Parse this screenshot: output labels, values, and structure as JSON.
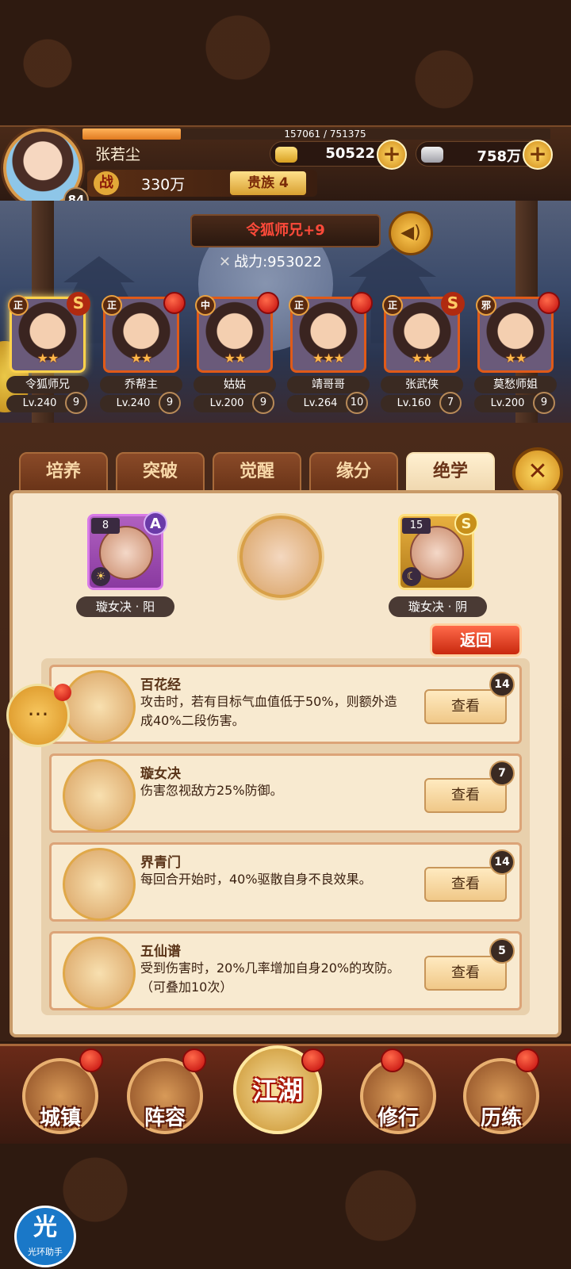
{
  "player": {
    "name": "张若尘",
    "level": "84",
    "exp_text": "157061 / 751375",
    "exp_fraction": 0.21,
    "gold": "50522",
    "silver": "758万",
    "power_icon": "战",
    "power": "330万",
    "noble": "贵族 4"
  },
  "scene": {
    "hero_title": "令狐师兄+9",
    "hero_power_label": "战力:",
    "hero_power_value": "953022",
    "sound_icon": "speaker-icon"
  },
  "heroes": [
    {
      "faction": "正",
      "name": "令狐师兄",
      "level": "Lv.240",
      "star_num": "9",
      "stars": 2,
      "badge": "S"
    },
    {
      "faction": "正",
      "name": "乔帮主",
      "level": "Lv.240",
      "star_num": "9",
      "stars": 2,
      "badge": "dot"
    },
    {
      "faction": "中",
      "name": "姑姑",
      "level": "Lv.200",
      "star_num": "9",
      "stars": 2,
      "badge": "dot"
    },
    {
      "faction": "正",
      "name": "靖哥哥",
      "level": "Lv.264",
      "star_num": "10",
      "stars": 3,
      "badge": "dot"
    },
    {
      "faction": "正",
      "name": "张武侠",
      "level": "Lv.160",
      "star_num": "7",
      "stars": 2,
      "badge": "S"
    },
    {
      "faction": "邪",
      "name": "莫愁师姐",
      "level": "Lv.200",
      "star_num": "9",
      "stars": 2,
      "badge": "dot"
    }
  ],
  "tabs": [
    "培养",
    "突破",
    "觉醒",
    "缘分",
    "绝学"
  ],
  "active_tab": "绝学",
  "skill_slots": {
    "left": {
      "count": "8",
      "grade": "A",
      "label": "璇女决 · 阳"
    },
    "right": {
      "count": "15",
      "grade": "S",
      "label": "璇女决 · 阴"
    }
  },
  "back_label": "返回",
  "view_label": "查看",
  "skills": [
    {
      "name": "百花经",
      "desc": "攻击时，若有目标气血值低于50%，则额外造成40%二段伤害。",
      "count": "14"
    },
    {
      "name": "璇女决",
      "desc": "伤害忽视敌方25%防御。",
      "count": "7"
    },
    {
      "name": "界青门",
      "desc": "每回合开始时，40%驱散自身不良效果。",
      "count": "14"
    },
    {
      "name": "五仙谱",
      "desc": "受到伤害时，20%几率增加自身20%的攻防。（可叠加10次）",
      "count": "5"
    }
  ],
  "nav": [
    "城镇",
    "阵容",
    "江湖",
    "修行",
    "历练"
  ],
  "helper": {
    "glyph": "光",
    "text": "光环助手"
  },
  "colors": {
    "accent_gold": "#e8a840",
    "active_tab": "#f6e6cc",
    "alert_red": "#c00a0a"
  }
}
